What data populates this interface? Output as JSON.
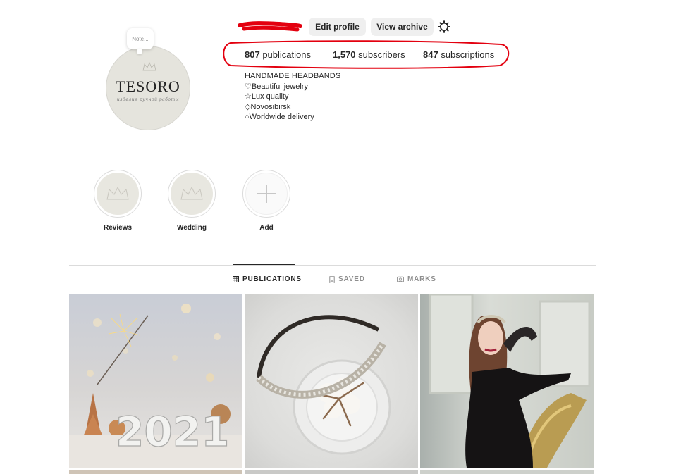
{
  "profile": {
    "note_text": "Note...",
    "avatar_brand": "TESORO",
    "avatar_script": "изделия ручной работы",
    "edit_profile_label": "Edit profile",
    "view_archive_label": "View archive",
    "settings_icon": "gear-icon"
  },
  "stats": {
    "publications_count": "807",
    "publications_label": "publications",
    "subscribers_count": "1,570",
    "subscribers_label": "subscribers",
    "subscriptions_count": "847",
    "subscriptions_label": "subscriptions",
    "highlight_color": "#e3000f"
  },
  "bio": {
    "name": "HANDMADE HEADBANDS",
    "lines": [
      "♡Beautiful jewelry",
      "☆Lux quality",
      "◇Novosibirsk",
      "○Worldwide delivery"
    ]
  },
  "highlights": [
    {
      "label": "Reviews"
    },
    {
      "label": "Wedding"
    },
    {
      "label": "Add"
    }
  ],
  "tabs": [
    {
      "label": "PUBLICATIONS",
      "icon": "grid-icon",
      "active": true
    },
    {
      "label": "SAVED",
      "icon": "bookmark-icon",
      "active": false
    },
    {
      "label": "MARKS",
      "icon": "tag-icon",
      "active": false
    }
  ],
  "posts": [
    {
      "label": "2021"
    },
    {
      "label": ""
    },
    {
      "label": ""
    }
  ]
}
